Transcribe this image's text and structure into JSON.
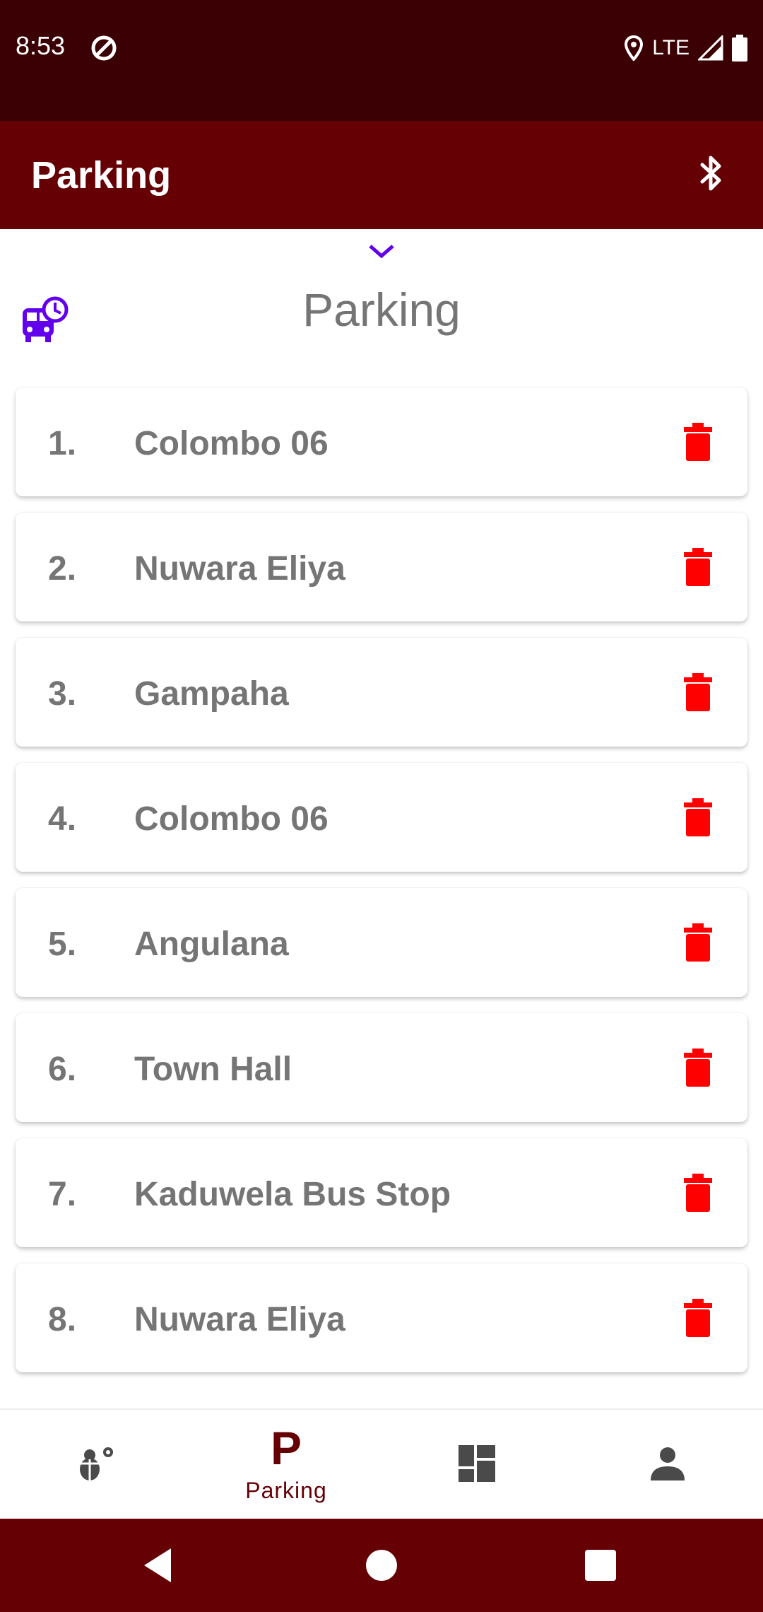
{
  "status_bar": {
    "time": "8:53",
    "network": "LTE",
    "icons": [
      "dnd-icon",
      "location-icon",
      "signal-icon",
      "battery-icon"
    ]
  },
  "app_bar": {
    "title": "Parking",
    "action_icon": "bluetooth-icon"
  },
  "section": {
    "title": "Parking",
    "collapse_icon": "chevron-down-icon",
    "leading_icon": "bus-clock-icon"
  },
  "parking_list": [
    {
      "index": "1.",
      "name": "Colombo 06"
    },
    {
      "index": "2.",
      "name": "Nuwara Eliya"
    },
    {
      "index": "3.",
      "name": "Gampaha"
    },
    {
      "index": "4.",
      "name": "Colombo 06"
    },
    {
      "index": "5.",
      "name": "Angulana"
    },
    {
      "index": "6.",
      "name": "Town Hall"
    },
    {
      "index": "7.",
      "name": "Kaduwela Bus Stop"
    },
    {
      "index": "8.",
      "name": "Nuwara Eliya"
    }
  ],
  "bottom_nav": {
    "items": [
      {
        "icon": "bug-icon",
        "label": ""
      },
      {
        "icon": "parking-icon",
        "glyph": "P",
        "label": "Parking",
        "active": true
      },
      {
        "icon": "dashboard-icon",
        "label": ""
      },
      {
        "icon": "person-icon",
        "label": ""
      }
    ]
  },
  "colors": {
    "status_bar": "#3b0003",
    "app_bar": "#650005",
    "accent": "#6200ee",
    "delete": "#ff0000",
    "text_muted": "#757575"
  }
}
